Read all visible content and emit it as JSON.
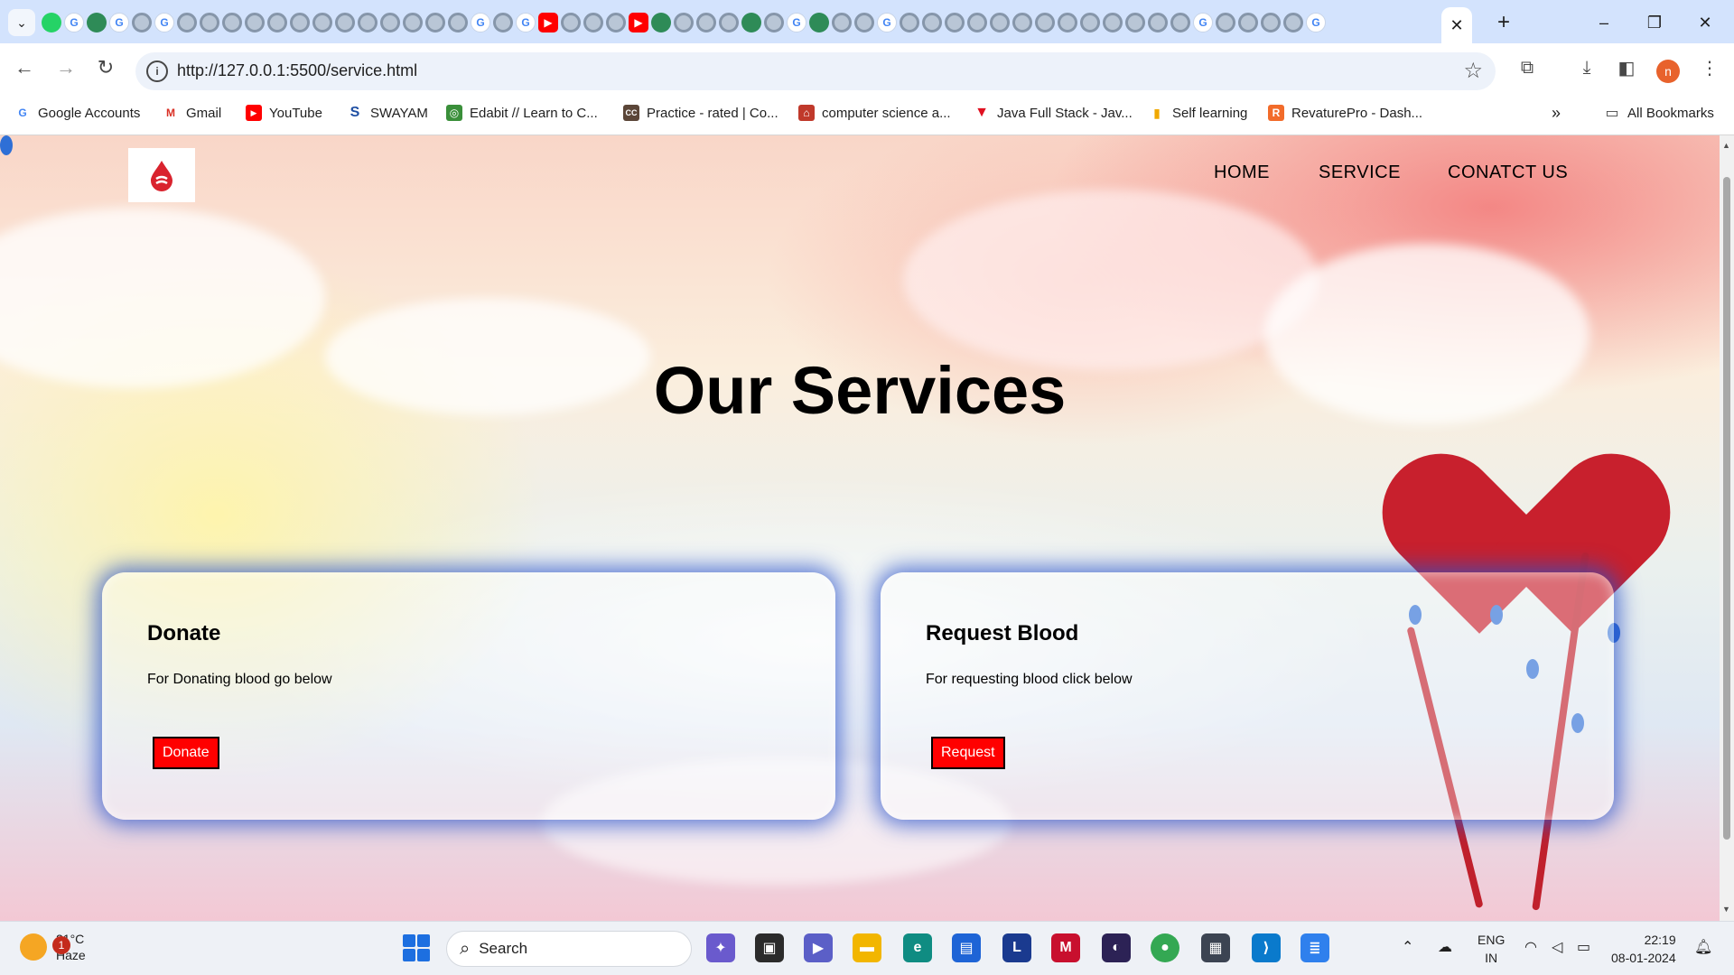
{
  "browser": {
    "url": "http://127.0.0.1:5500/service.html",
    "bookmarks": [
      {
        "label": "Google Accounts",
        "icon": "google-icon"
      },
      {
        "label": "Gmail",
        "icon": "gmail-icon"
      },
      {
        "label": "YouTube",
        "icon": "youtube-icon"
      },
      {
        "label": "SWAYAM",
        "icon": "swayam-icon"
      },
      {
        "label": "Edabit // Learn to C...",
        "icon": "edabit-icon"
      },
      {
        "label": "Practice - rated | Co...",
        "icon": "codechef-icon"
      },
      {
        "label": "computer science a...",
        "icon": "home-icon"
      },
      {
        "label": "Java Full Stack - Jav...",
        "icon": "java-icon"
      },
      {
        "label": "Self learning",
        "icon": "chart-icon"
      },
      {
        "label": "RevaturePro - Dash...",
        "icon": "revature-icon"
      }
    ],
    "all_bookmarks": "All Bookmarks",
    "profile_initial": "n"
  },
  "page": {
    "nav": {
      "home": "HOME",
      "service": "SERVICE",
      "contact": "CONATCT US"
    },
    "heading": "Our Services",
    "cards": [
      {
        "title": "Donate",
        "text": "For Donating blood go below",
        "button": "Donate"
      },
      {
        "title": "Request Blood",
        "text": "For requesting blood click below",
        "button": "Request"
      }
    ]
  },
  "taskbar": {
    "weather_badge": "1",
    "temperature": "21°C",
    "condition": "Haze",
    "search_label": "Search",
    "lang_line1": "ENG",
    "lang_line2": "IN",
    "time": "22:19",
    "date": "08-01-2024"
  },
  "colors": {
    "button_red": "#ff0000",
    "card_glow": "#2850c8",
    "tabstrip": "#d3e3fd"
  }
}
